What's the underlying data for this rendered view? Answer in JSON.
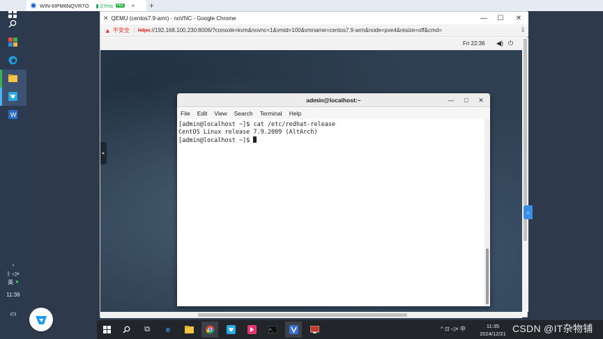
{
  "remote_client": {
    "tab_title": "WIN-6IPM6NQVR7O",
    "latency": "27ms",
    "quality_badge": "HD",
    "tab_close": "×",
    "new_tab": "+"
  },
  "outer_sidebar": {
    "tray_lang": "英",
    "time": "11:36"
  },
  "chrome": {
    "window_title": "QEMU (centos7.9-arm) - noVNC - Google Chrome",
    "address": {
      "security_label": "不安全",
      "separator": "|",
      "scheme": "https",
      "rest": "://192.168.100.230:8006/?console=kvm&novnc=1&vmid=100&vmname=centos7.9-arm&node=pve4&resize=off&cmd="
    },
    "controls": {
      "minimize": "—",
      "maximize": "☐",
      "close": "✕"
    }
  },
  "vm": {
    "topbar_clock": "Fri 22:36",
    "terminal": {
      "title": "admin@localhost:~",
      "menu": [
        "File",
        "Edit",
        "View",
        "Search",
        "Terminal",
        "Help"
      ],
      "lines": [
        "[admin@localhost ~]$ cat /etc/redhat-release",
        "CentOS Linux release 7.9.2009 (AltArch)",
        "[admin@localhost ~]$ "
      ]
    }
  },
  "taskbar": {
    "clock_time": "11:35",
    "clock_date": "2024/12/21",
    "ime": "中"
  },
  "watermark": "CSDN @IT杂物铺",
  "colors": {
    "accent_blue": "#3a8ee6",
    "warning_red": "#d93025",
    "sidebar_bg": "#2b3a4f",
    "taskbar_bg": "#22262b"
  }
}
